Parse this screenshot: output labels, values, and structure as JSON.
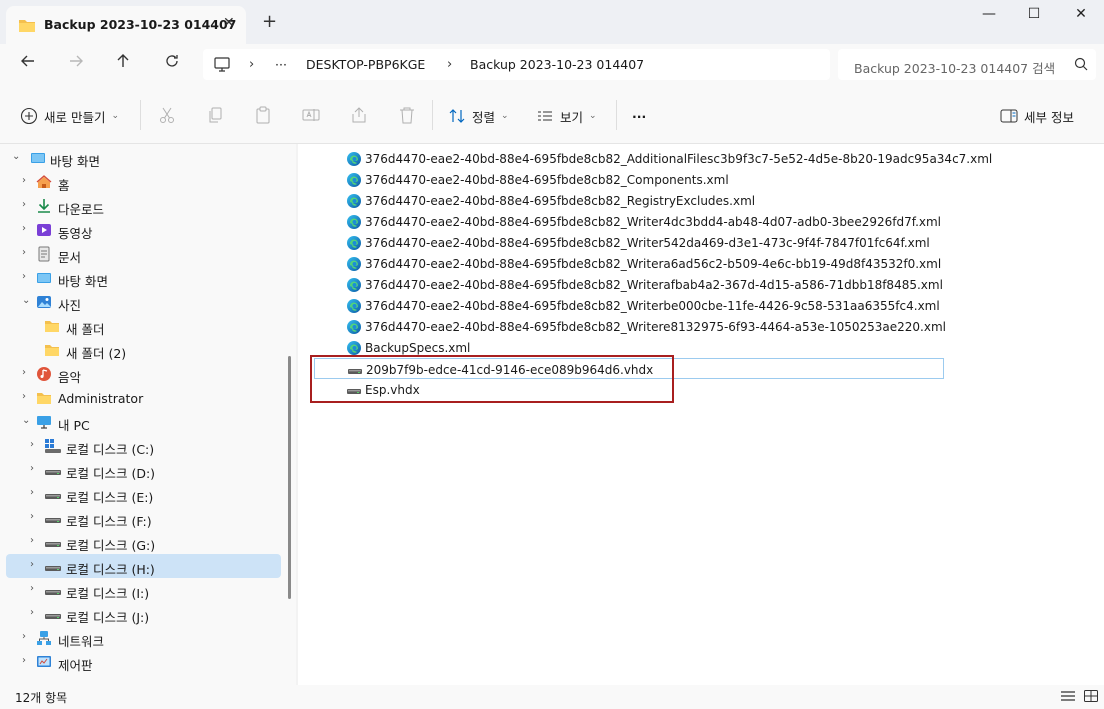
{
  "window": {
    "tab_title": "Backup 2023-10-23 014407",
    "tab_close": "✕",
    "new_tab": "+",
    "minimize": "—",
    "maximize": "☐",
    "close": "✕"
  },
  "address": {
    "more": "···",
    "crumbs": [
      "DESKTOP-PBP6KGE",
      "Backup 2023-10-23 014407"
    ],
    "search_placeholder": "Backup 2023-10-23 014407 검색"
  },
  "toolbar": {
    "new_label": "새로 만들기",
    "sort_label": "정렬",
    "view_label": "보기",
    "more": "···",
    "details_label": "세부 정보"
  },
  "sidebar": {
    "items": [
      {
        "label": "바탕 화면",
        "icon": "desktop-icon"
      },
      {
        "label": "홈",
        "icon": "home-icon"
      },
      {
        "label": "다운로드",
        "icon": "download-icon"
      },
      {
        "label": "동영상",
        "icon": "video-icon"
      },
      {
        "label": "문서",
        "icon": "document-icon"
      },
      {
        "label": "바탕 화면",
        "icon": "desktop-icon"
      },
      {
        "label": "사진",
        "icon": "pictures-icon"
      },
      {
        "label": "새 폴더",
        "icon": "folder-icon"
      },
      {
        "label": "새 폴더 (2)",
        "icon": "folder-icon"
      },
      {
        "label": "음악",
        "icon": "music-icon"
      },
      {
        "label": "Administrator",
        "icon": "folder-icon"
      },
      {
        "label": "내 PC",
        "icon": "pc-icon"
      },
      {
        "label": "로컬 디스크 (C:)",
        "icon": "windows-drive-icon"
      },
      {
        "label": "로컬 디스크 (D:)",
        "icon": "drive-icon"
      },
      {
        "label": "로컬 디스크 (E:)",
        "icon": "drive-icon"
      },
      {
        "label": "로컬 디스크 (F:)",
        "icon": "drive-icon"
      },
      {
        "label": "로컬 디스크 (G:)",
        "icon": "drive-icon"
      },
      {
        "label": "로컬 디스크 (H:)",
        "icon": "drive-icon"
      },
      {
        "label": "로컬 디스크 (I:)",
        "icon": "drive-icon"
      },
      {
        "label": "로컬 디스크 (J:)",
        "icon": "drive-icon"
      },
      {
        "label": "네트워크",
        "icon": "network-icon"
      },
      {
        "label": "제어판",
        "icon": "control-panel-icon"
      }
    ],
    "selected_label": "로컬 디스크 (H:)"
  },
  "files": [
    {
      "name": "376d4470-eae2-40bd-88e4-695fbde8cb82_AdditionalFilesc3b9f3c7-5e52-4d5e-8b20-19adc95a34c7.xml",
      "icon": "edge-xml-icon"
    },
    {
      "name": "376d4470-eae2-40bd-88e4-695fbde8cb82_Components.xml",
      "icon": "edge-xml-icon"
    },
    {
      "name": "376d4470-eae2-40bd-88e4-695fbde8cb82_RegistryExcludes.xml",
      "icon": "edge-xml-icon"
    },
    {
      "name": "376d4470-eae2-40bd-88e4-695fbde8cb82_Writer4dc3bdd4-ab48-4d07-adb0-3bee2926fd7f.xml",
      "icon": "edge-xml-icon"
    },
    {
      "name": "376d4470-eae2-40bd-88e4-695fbde8cb82_Writer542da469-d3e1-473c-9f4f-7847f01fc64f.xml",
      "icon": "edge-xml-icon"
    },
    {
      "name": "376d4470-eae2-40bd-88e4-695fbde8cb82_Writera6ad56c2-b509-4e6c-bb19-49d8f43532f0.xml",
      "icon": "edge-xml-icon"
    },
    {
      "name": "376d4470-eae2-40bd-88e4-695fbde8cb82_Writerafbab4a2-367d-4d15-a586-71dbb18f8485.xml",
      "icon": "edge-xml-icon"
    },
    {
      "name": "376d4470-eae2-40bd-88e4-695fbde8cb82_Writerbe000cbe-11fe-4426-9c58-531aa6355fc4.xml",
      "icon": "edge-xml-icon"
    },
    {
      "name": "376d4470-eae2-40bd-88e4-695fbde8cb82_Writere8132975-6f93-4464-a53e-1050253ae220.xml",
      "icon": "edge-xml-icon"
    },
    {
      "name": "BackupSpecs.xml",
      "icon": "edge-xml-icon"
    },
    {
      "name": "209b7f9b-edce-41cd-9146-ece089b964d6.vhdx",
      "icon": "vhdx-icon"
    },
    {
      "name": "Esp.vhdx",
      "icon": "vhdx-icon"
    }
  ],
  "status": {
    "item_count": "12개 항목"
  },
  "colors": {
    "accent": "#0067c0",
    "selected_row": "#cde3f7",
    "highlight_box": "#a81f1f"
  }
}
